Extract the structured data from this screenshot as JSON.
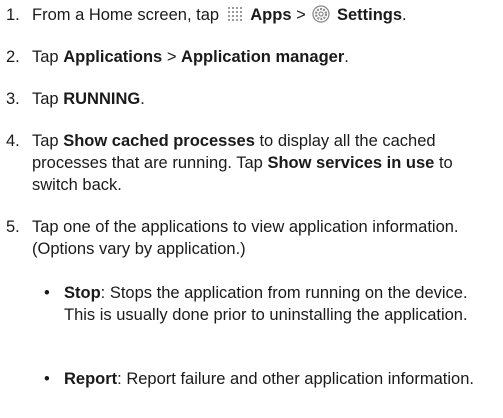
{
  "steps": [
    {
      "num": "1.",
      "pre": "From a Home screen, tap",
      "apps": "Apps",
      "sep": ">",
      "settings": "Settings",
      "end": "."
    },
    {
      "num": "2.",
      "pre": "Tap",
      "b1": "Applications",
      "sep": ">",
      "b2": "Application manager",
      "end": "."
    },
    {
      "num": "3.",
      "pre": "Tap",
      "b1": "RUNNING",
      "end": "."
    },
    {
      "num": "4.",
      "pre": "Tap",
      "b1": "Show cached processes",
      "mid": "to display all the cached processes that are running. Tap",
      "b2": "Show services in use",
      "end": "to switch back."
    },
    {
      "num": "5.",
      "text": "Tap one of the applications to view application information. (Options vary by application.)"
    }
  ],
  "bullets": [
    {
      "term": "Stop",
      "desc": ": Stops the application from running on the device. This is usually done prior to uninstalling the application."
    },
    {
      "term": "Report",
      "desc": ": Report failure and other application information."
    }
  ],
  "icons": {
    "apps": "apps-grid-icon",
    "settings": "settings-gear-icon"
  },
  "colors": {
    "text": "#1a1a1a",
    "icon": "#9a9a9a"
  }
}
